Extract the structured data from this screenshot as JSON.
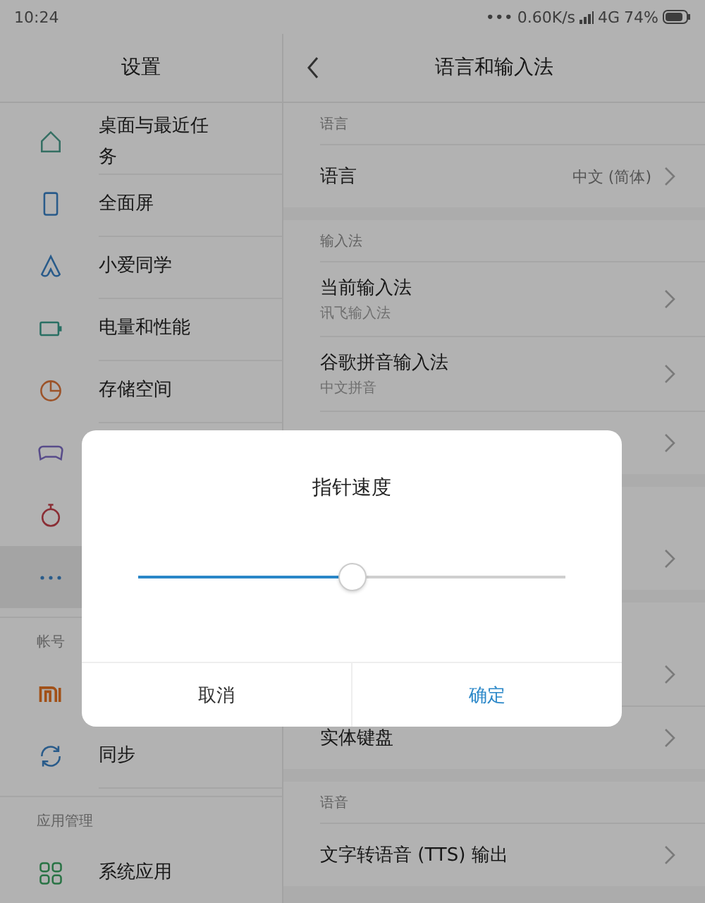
{
  "status_bar": {
    "time": "10:24",
    "dots": "•••",
    "speed": "0.60K/s",
    "network": "4G",
    "battery": "74%"
  },
  "sidebar": {
    "title": "设置",
    "sections": [
      {
        "items": [
          {
            "label": "桌面与最近任务",
            "selected": false
          },
          {
            "label": "全面屏",
            "selected": false
          },
          {
            "label": "小爱同学",
            "selected": false
          },
          {
            "label": "电量和性能",
            "selected": false
          },
          {
            "label": "存储空间",
            "selected": false
          },
          {
            "selected": false
          },
          {
            "selected": false
          },
          {
            "selected": true
          }
        ]
      },
      {
        "header": "帐号",
        "items": [
          {
            "selected": false
          },
          {
            "label": "同步",
            "selected": false
          }
        ]
      },
      {
        "header": "应用管理",
        "items": [
          {
            "label": "系统应用",
            "selected": false
          }
        ]
      }
    ]
  },
  "detail": {
    "title": "语言和输入法",
    "sections": [
      {
        "header": "语言",
        "items": [
          {
            "kind": "value",
            "title": "语言",
            "value": "中文 (简体)"
          }
        ]
      },
      {
        "header": "输入法",
        "items": [
          {
            "kind": "subtitle",
            "title": "当前输入法",
            "subtitle": "讯飞输入法"
          },
          {
            "kind": "subtitle",
            "title": "谷歌拼音输入法",
            "subtitle": "中文拼音"
          },
          {
            "kind": "covered"
          }
        ]
      },
      {
        "items": [
          {
            "kind": "covered"
          }
        ]
      },
      {
        "items": [
          {
            "kind": "covered"
          },
          {
            "kind": "plain",
            "title": "实体键盘"
          }
        ]
      },
      {
        "header": "语音",
        "items": [
          {
            "kind": "plain",
            "title": "文字转语音 (TTS) 输出"
          }
        ]
      }
    ]
  },
  "dialog": {
    "title": "指针速度",
    "slider": {
      "level": 0.5
    },
    "buttons": [
      {
        "label": "取消",
        "kind": "cancel"
      },
      {
        "label": "确定",
        "kind": "confirm"
      }
    ]
  }
}
